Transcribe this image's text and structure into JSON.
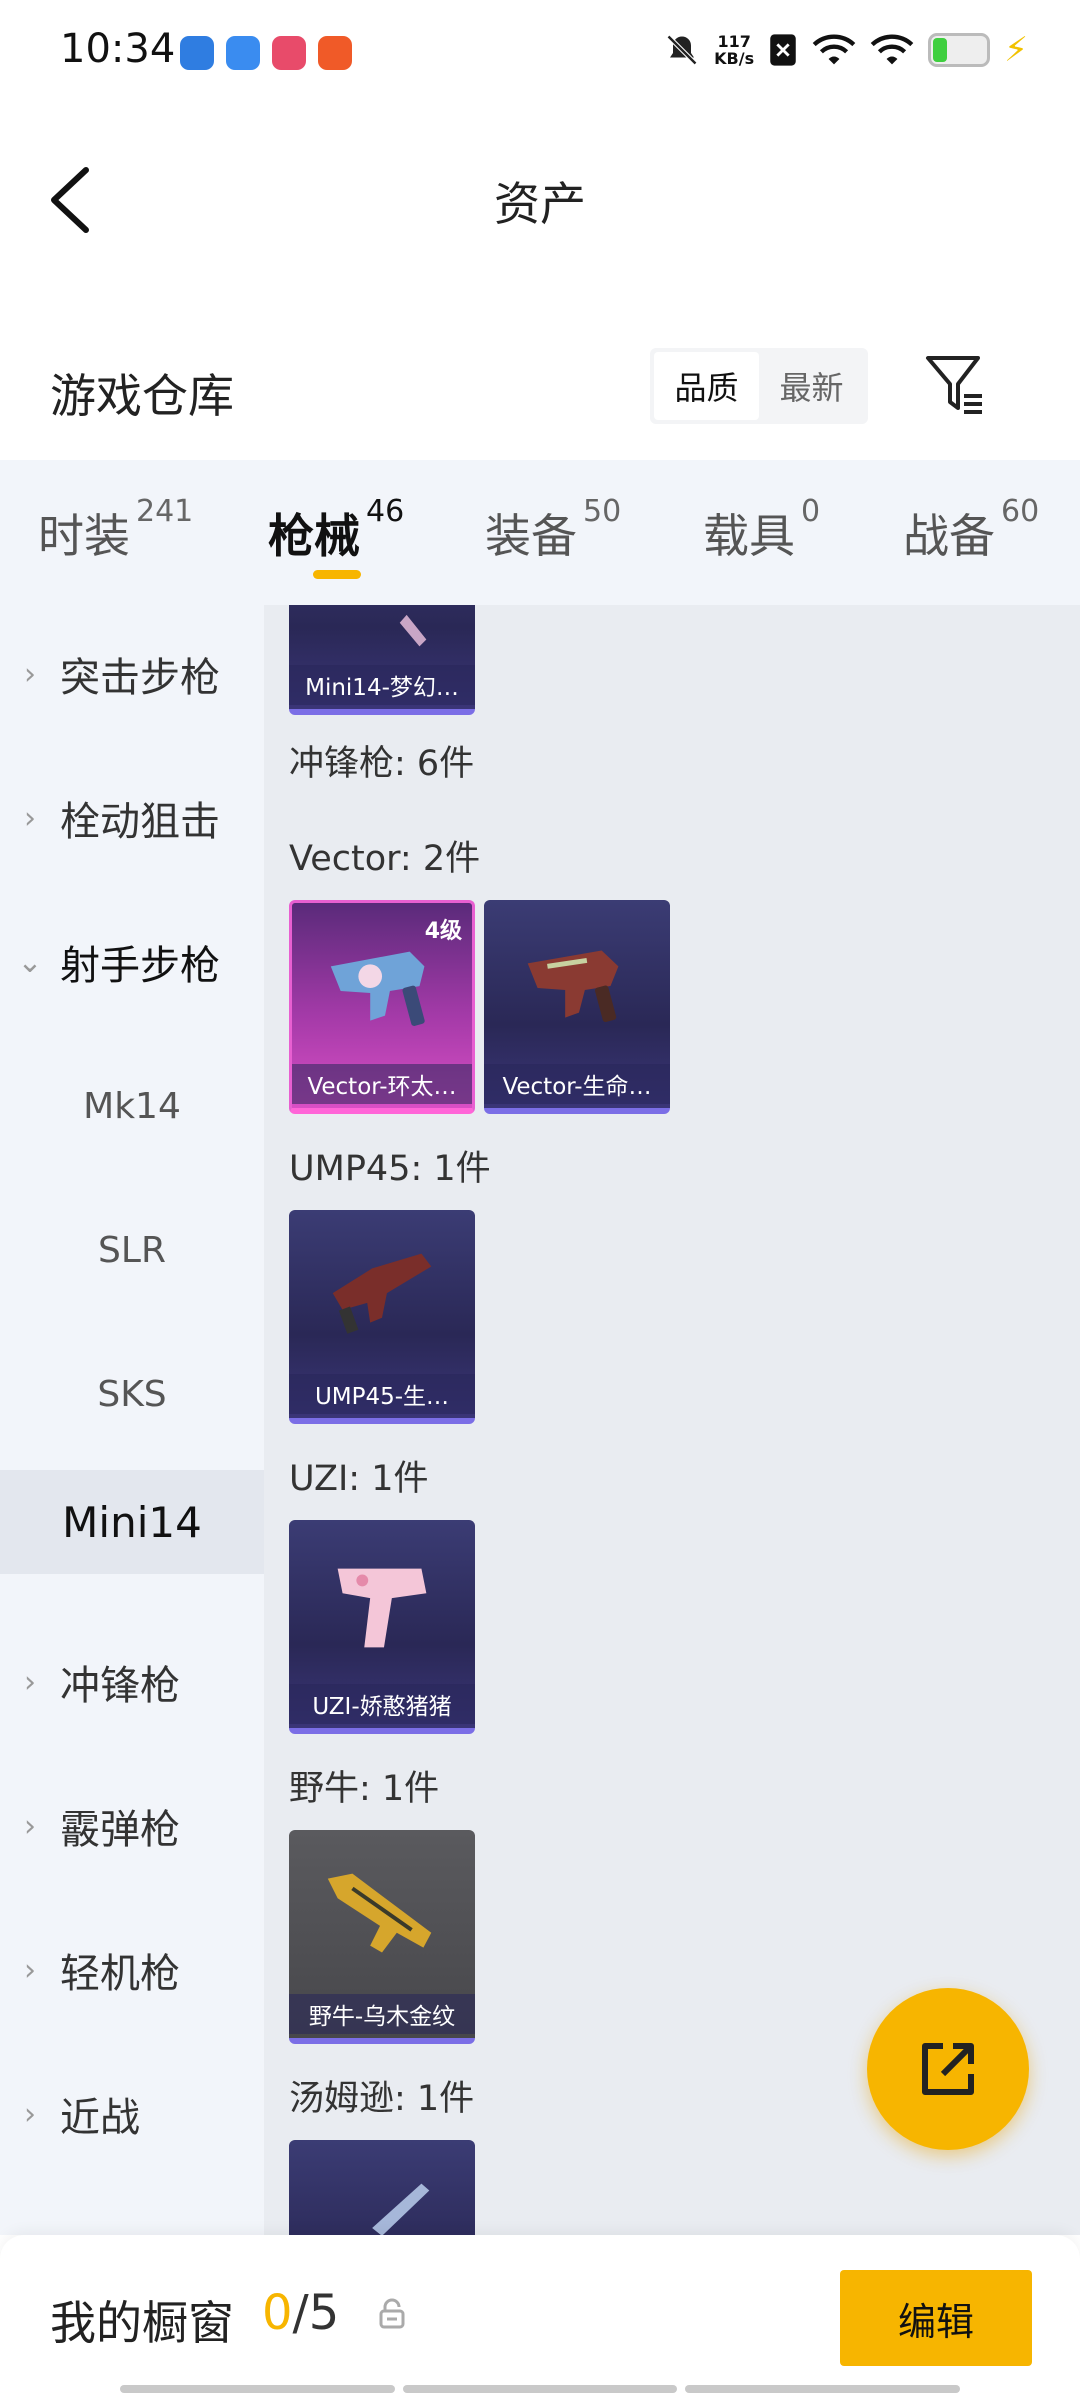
{
  "status_bar": {
    "time": "10:34",
    "net_speed_value": "117",
    "net_speed_unit": "KB/s",
    "icons": [
      "mute-icon",
      "sim-icon",
      "wifi-icon",
      "battery-icon",
      "charging-icon"
    ]
  },
  "header": {
    "title": "资产",
    "back_icon": "chevron-left-icon"
  },
  "warehouse": {
    "title": "游戏仓库",
    "sort_options": [
      "品质",
      "最新"
    ],
    "selected_sort": "品质",
    "filter_icon": "filter-icon"
  },
  "tabs": [
    {
      "label": "时装",
      "count": "241"
    },
    {
      "label": "枪械",
      "count": "46"
    },
    {
      "label": "装备",
      "count": "50"
    },
    {
      "label": "载具",
      "count": "0"
    },
    {
      "label": "战备",
      "count": "60"
    }
  ],
  "active_tab": "枪械",
  "sidebar": {
    "items": [
      {
        "label": "突击步枪",
        "type": "group"
      },
      {
        "label": "栓动狙击",
        "type": "group"
      },
      {
        "label": "射手步枪",
        "type": "group-expanded"
      },
      {
        "label": "Mk14",
        "type": "sub"
      },
      {
        "label": "SLR",
        "type": "sub"
      },
      {
        "label": "SKS",
        "type": "sub"
      },
      {
        "label": "Mini14",
        "type": "sub-selected"
      },
      {
        "label": "冲锋枪",
        "type": "group"
      },
      {
        "label": "霰弹枪",
        "type": "group"
      },
      {
        "label": "轻机枪",
        "type": "group"
      },
      {
        "label": "近战",
        "type": "group"
      }
    ]
  },
  "content": {
    "top_card_label": "Mini14-梦幻…",
    "category_header": "冲锋枪: 6件",
    "groups": [
      {
        "label": "Vector: 2件",
        "cards": [
          {
            "label": "Vector-环太…",
            "badge": "4级",
            "style": "pink"
          },
          {
            "label": "Vector-生命…",
            "style": "purple"
          }
        ]
      },
      {
        "label": "UMP45: 1件",
        "cards": [
          {
            "label": "UMP45-生…",
            "style": "purple"
          }
        ]
      },
      {
        "label": "UZI: 1件",
        "cards": [
          {
            "label": "UZI-娇憨猪猪",
            "style": "purple"
          }
        ]
      },
      {
        "label": "野牛: 1件",
        "cards": [
          {
            "label": "野牛-乌木金纹",
            "style": "gray"
          }
        ]
      },
      {
        "label": "汤姆逊: 1件",
        "cards": []
      }
    ]
  },
  "fab": {
    "icon": "share-external-icon"
  },
  "bottom_bar": {
    "label": "我的橱窗",
    "current": "0",
    "total": "/5",
    "lock_icon": "lock-icon",
    "edit_label": "编辑"
  },
  "colors": {
    "accent": "#f7b500",
    "tab_bg": "#f2f5fa",
    "content_bg": "#e9ecf1"
  }
}
